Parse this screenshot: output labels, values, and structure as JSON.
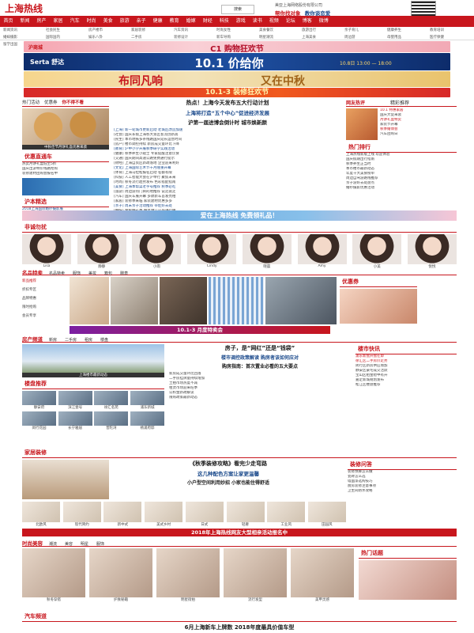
{
  "header": {
    "logo_text": "上海热线",
    "search_label": "搜索",
    "slogan1": "帮你找对象",
    "slogan2": "教你谈恋爱",
    "company_line": "美亚上海网络股份有限公司"
  },
  "nav": {
    "items": [
      "首页",
      "新闻",
      "房产",
      "家居",
      "汽车",
      "时尚",
      "美食",
      "旅游",
      "亲子",
      "健康",
      "教育",
      "婚嫁",
      "财经",
      "科技",
      "游戏",
      "读书",
      "视频",
      "论坛",
      "博客",
      "微博"
    ]
  },
  "subnav": {
    "items": [
      "新闻资讯",
      "社会民生",
      "房产楼市",
      "家居装修",
      "汽车资讯",
      "时尚女性",
      "美食餐饮",
      "旅游出行",
      "亲子育儿",
      "健康养生",
      "教育培训",
      "婚嫁摄影",
      "国际国内",
      "娱乐八卦",
      "二手房",
      "装修设计",
      "新车导购",
      "明星潮流",
      "上海美食",
      "周边游",
      "母婴用品",
      "医疗保健",
      "留学出国",
      "婚纱礼服"
    ]
  },
  "banners": {
    "b1_left": "沪商城",
    "b1_text": "C1 购物狂欢节",
    "b2_brand": "Serta 舒达",
    "b2_text": "10.1 价给你",
    "b2_right": "10.8日 13:00 — 18:00",
    "b3_text1": "布同凡响",
    "b3_text2": "又在中秋",
    "b4_text": "10.1-3 装修狂欢节"
  },
  "left_col": {
    "tabs": [
      "热门活动",
      "优惠券",
      "你不得不看"
    ],
    "caption": "中秋佳节月饼礼盒优惠来袭",
    "promo_title": "优惠直通车",
    "promo_lines": [
      "热卖月饼礼盒低至5折",
      "国庆出游特价线路抢购",
      "装修建材团购会报名中"
    ],
    "ad_title": "沪本精选",
    "ad_lines": [
      "2018上海国际婚纱摄影展",
      "家装节满减优惠活动"
    ]
  },
  "center": {
    "headline1": "热点！上海今天发布五大行动计划",
    "headline2": "上海将打造“五个中心”促进经济发展",
    "headline3": "沪第一届进博会倒计时 城市焕新颜",
    "news": [
      "[上海] 新一轮城市更新启动 老城区改造加速",
      "[社会] 国庆长假上海各大景区客流创新高",
      "[民生] 本市地铁多条线路国庆延长运营时间",
      "[房产] 楼市调控持续 新房成交量环比下降",
      "[教育] 沪中小学开展秋季研学实践活动",
      "[健康] 秋季养生小贴士 专家提醒注意饮食",
      "[交通] 国庆期间高速公路免费通行提示",
      "[财经] 上海自贸区新政落地 企业迎来利好",
      "[文化] 上海国际艺术节十月隆重开幕",
      "[体育] 上海马拉松报名启动 名额有限",
      "[科技] 人工智能大会在沪举行 聚焦未来",
      "[时尚] 秋冬流行趋势发布 色彩搭配指南",
      "[美食] 上海本帮菜老字号推荐 秋季必吃",
      "[旅游] 周边游热门目的地推荐 说走就走",
      "[汽车] 国庆车展开幕 多款新车首发亮相",
      "[家居] 装修季来临 家装建材优惠多多",
      "[亲子] 周末亲子活动推荐 带娃好去处",
      "[婚嫁] 金秋婚礼季 婚宴预订火热进行中"
    ]
  },
  "right_col": {
    "title1": "网友热评",
    "title2": "精彩推荐",
    "hot_items": [
      "10.1 特惠家居",
      "国庆大促来袭",
      "月饼礼盒特卖",
      "家装节开幕",
      "秋季婚博会",
      "汽车团购日"
    ],
    "list_title": "热门排行",
    "list": [
      "上海热线新版上线 欢迎体验",
      "国庆假期出行指南",
      "秋季养生正当时",
      "本市楼市最新动态",
      "年度十大美食榜单",
      "周边自驾游路线推荐",
      "亲子游好去处盘点",
      "婚纱摄影优惠活动"
    ]
  },
  "wide_banner": {
    "text": "爱在上海热线 免费领礼品！"
  },
  "people": {
    "title": "非诚勿扰",
    "names": [
      "Lisa",
      "静静",
      "小雨",
      "Cindy",
      "晓晨",
      "Amy",
      "小美",
      "悦悦"
    ]
  },
  "products": {
    "title": "名品特卖",
    "tabs": [
      "名品特卖",
      "服饰",
      "美妆",
      "箱包",
      "腕表"
    ],
    "side_links": [
      "新品推荐",
      "折扣专区",
      "品牌特惠",
      "限时抢购",
      "会员专享"
    ],
    "banner_text": "10.1-3 月度特卖会",
    "right_title": "优惠券"
  },
  "house": {
    "title": "房产频道",
    "tabs": [
      "新房",
      "二手房",
      "租房",
      "楼盘"
    ],
    "caption": "上海楼市最新动态",
    "headline1": "房子，是“网红”还是“钱袋”",
    "headline2": "楼市调控政策解读 购房者该如何应对",
    "headline3": "购房指南：首次置业必看的五大要点",
    "sub_title": "楼盘推荐",
    "listings": [
      "静安府",
      "滨江壹号",
      "徐汇名苑",
      "浦东新城",
      "闵行花园",
      "长宁雅居",
      "普陀湾",
      "杨浦府邸"
    ],
    "news": [
      "新房成交量环比回落",
      "二手房挂牌量持续增加",
      "土拍市场热度不减",
      "租赁市场迎来旺季",
      "公积金新政解读",
      "限购政策最新动态"
    ],
    "right_title": "楼市快讯",
    "right_list": [
      "浦东新盘开盘在即",
      "徐汇区二手房价走势",
      "闵行区新房供应增加",
      "静安区豪宅成交活跃",
      "宝山区租金稳中有升",
      "嘉定新城规划发布",
      "松江区楼盘推荐"
    ]
  },
  "home": {
    "title": "家居装修",
    "headline1": "《秋季装修攻略》看完少走弯路",
    "headline2": "这几种配色方案让家更温馨",
    "headline3": "小户型空间利用妙招 小家也能住得舒适",
    "items": [
      "北欧风",
      "现代简约",
      "新中式",
      "美式乡村",
      "日式",
      "轻奢",
      "工业风",
      "田园风"
    ],
    "right_title": "装修问答",
    "right_list": [
      "装修预算怎么做",
      "瓷砖怎么选",
      "墙面漆选购技巧",
      "厨房装修注意事项",
      "卫生间防水攻略"
    ]
  },
  "red_banner": {
    "text": "2018年上海热线网友大型相亲活动报名中"
  },
  "fashion": {
    "title": "时尚美容",
    "tabs": [
      "潮流",
      "美容",
      "明星",
      "服饰"
    ],
    "items": [
      "秋冬穿搭",
      "护肤秘籍",
      "明星街拍",
      "流行发型",
      "美甲灵感"
    ],
    "right_title": "热门话题"
  },
  "car": {
    "title": "汽车频道",
    "headline": "6月上海新车上牌数 2018年度最具价值车型"
  }
}
